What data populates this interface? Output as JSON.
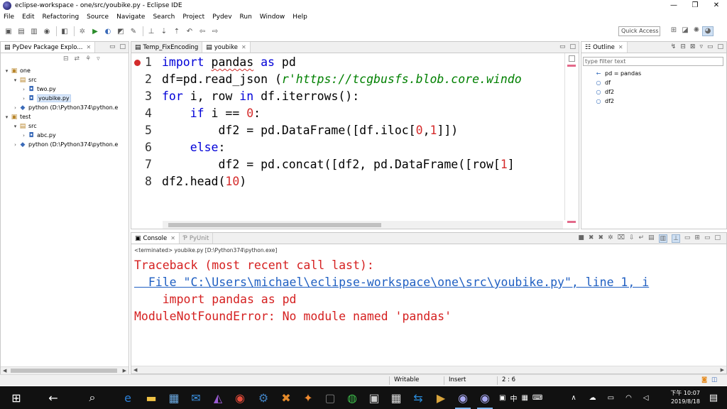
{
  "window": {
    "title": "eclipse-workspace - one/src/youbike.py - Eclipse IDE",
    "controls": [
      "—",
      "❐",
      "✕"
    ]
  },
  "menu": [
    "File",
    "Edit",
    "Refactoring",
    "Source",
    "Navigate",
    "Search",
    "Project",
    "Pydev",
    "Run",
    "Window",
    "Help"
  ],
  "toolbar": {
    "quick_access": "Quick Access"
  },
  "package_explorer": {
    "tab": "PyDev Package Explo...",
    "tree": [
      {
        "indent": 0,
        "twisty": "▾",
        "icon": "▣",
        "icon_class": "proj",
        "label": "one",
        "selected": false
      },
      {
        "indent": 1,
        "twisty": "▾",
        "icon": "▤",
        "icon_class": "src",
        "label": "src",
        "selected": false
      },
      {
        "indent": 2,
        "twisty": "›",
        "icon": "◘",
        "icon_class": "py",
        "label": "two.py",
        "selected": false
      },
      {
        "indent": 2,
        "twisty": "›",
        "icon": "◘",
        "icon_class": "py",
        "label": "youbike.py",
        "selected": true
      },
      {
        "indent": 1,
        "twisty": "›",
        "icon": "◆",
        "icon_class": "py",
        "label": "python  (D:\\Python374\\python.e",
        "selected": false
      },
      {
        "indent": 0,
        "twisty": "▾",
        "icon": "▣",
        "icon_class": "proj",
        "label": "test",
        "selected": false
      },
      {
        "indent": 1,
        "twisty": "▾",
        "icon": "▤",
        "icon_class": "src",
        "label": "src",
        "selected": false
      },
      {
        "indent": 2,
        "twisty": "›",
        "icon": "◘",
        "icon_class": "py",
        "label": "abc.py",
        "selected": false
      },
      {
        "indent": 1,
        "twisty": "›",
        "icon": "◆",
        "icon_class": "py",
        "label": "python  (D:\\Python374\\python.e",
        "selected": false
      }
    ]
  },
  "editor": {
    "tabs": [
      {
        "label": "Temp_FixEncoding",
        "active": false
      },
      {
        "label": "youbike",
        "active": true
      }
    ],
    "lines": [
      {
        "n": "1",
        "error": true,
        "tokens": [
          {
            "t": "import",
            "c": "kw"
          },
          {
            "t": " "
          },
          {
            "t": "pandas",
            "c": "squig"
          },
          {
            "t": " "
          },
          {
            "t": "as",
            "c": "kw"
          },
          {
            "t": " pd"
          }
        ]
      },
      {
        "n": "2",
        "tokens": [
          {
            "t": "df=pd.read_json ("
          },
          {
            "t": "r'https://tcgbusfs.blob.core.windo",
            "c": "str"
          }
        ]
      },
      {
        "n": "3",
        "tokens": [
          {
            "t": "for",
            "c": "kw"
          },
          {
            "t": " i, row "
          },
          {
            "t": "in",
            "c": "kw"
          },
          {
            "t": " df.iterrows():"
          }
        ]
      },
      {
        "n": "4",
        "tokens": [
          {
            "t": "    "
          },
          {
            "t": "if",
            "c": "kw"
          },
          {
            "t": " i == "
          },
          {
            "t": "0",
            "c": "num"
          },
          {
            "t": ":"
          }
        ]
      },
      {
        "n": "5",
        "tokens": [
          {
            "t": "        df2 = pd.DataFrame([df.iloc["
          },
          {
            "t": "0",
            "c": "num"
          },
          {
            "t": ","
          },
          {
            "t": "1",
            "c": "num"
          },
          {
            "t": "]])"
          }
        ]
      },
      {
        "n": "6",
        "tokens": [
          {
            "t": "    "
          },
          {
            "t": "else",
            "c": "kw"
          },
          {
            "t": ":"
          }
        ]
      },
      {
        "n": "7",
        "tokens": [
          {
            "t": "        df2 = pd.concat([df2, pd.DataFrame([row["
          },
          {
            "t": "1",
            "c": "num"
          },
          {
            "t": "]"
          }
        ]
      },
      {
        "n": "8",
        "tokens": [
          {
            "t": "df2.head("
          },
          {
            "t": "10",
            "c": "num"
          },
          {
            "t": ")"
          }
        ]
      }
    ]
  },
  "outline": {
    "tab": "Outline",
    "filter_placeholder": "type filter text",
    "items": [
      {
        "icon": "←",
        "label": "pd = pandas"
      },
      {
        "icon": "○",
        "label": "df"
      },
      {
        "icon": "○",
        "label": "df2"
      },
      {
        "icon": "○",
        "label": "df2"
      }
    ]
  },
  "console": {
    "tabs": [
      {
        "label": "Console",
        "active": true
      },
      {
        "label": "PyUnit",
        "active": false
      }
    ],
    "terminated": "<terminated> youbike.py [D:\\Python374\\python.exe]",
    "output": [
      {
        "text": "Traceback (most recent call last):",
        "link": false
      },
      {
        "text": "  File \"C:\\Users\\michael\\eclipse-workspace\\one\\src\\youbike.py\", line 1, i",
        "link": true
      },
      {
        "text": "    import pandas as pd",
        "link": false
      },
      {
        "text": "ModuleNotFoundError: No module named 'pandas'",
        "link": false
      }
    ]
  },
  "statusbar": {
    "writable": "Writable",
    "insert": "Insert",
    "position": "2 : 6"
  },
  "taskbar": {
    "time": "下午 10:07",
    "date": "2019/8/18",
    "ime": "中"
  }
}
